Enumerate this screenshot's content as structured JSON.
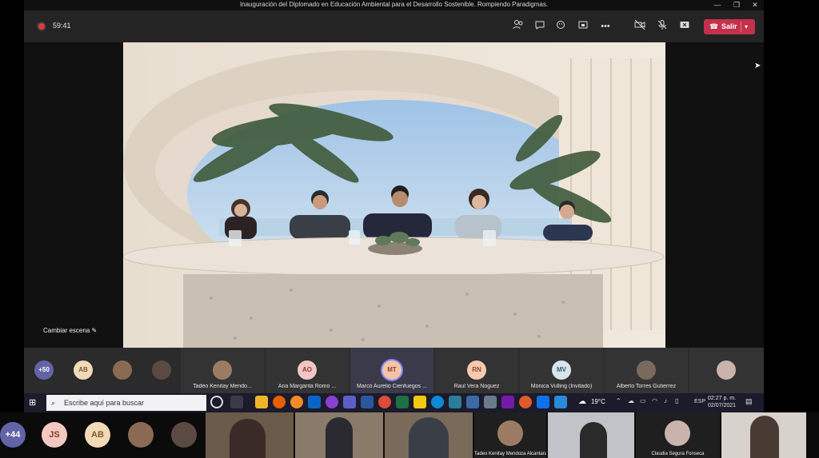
{
  "meeting": {
    "title": "Inauguración del Diplomado en Educación Ambiental para el Desarrollo Sostenible. Rompiendo Paradigmas.",
    "timer": "59:41",
    "leave_label": "Salir",
    "change_scene": "Cambiar escena"
  },
  "strip": {
    "overflow": "+50",
    "avatars": [
      {
        "initials": "AB",
        "color": "#f2d9b8"
      }
    ],
    "tiles": [
      {
        "name": "Tadeo Kenitay Mendo..."
      },
      {
        "name": "Ana Margarita Romo ...",
        "initials": "AO",
        "color": "#f3c6c6"
      },
      {
        "name": "Marco Aurelio Cienfuegos ...",
        "initials": "MT",
        "color": "#f5c4a8"
      },
      {
        "name": "Raul Vera Noguez",
        "initials": "RN",
        "color": "#f6c9b0"
      },
      {
        "name": "Mónica Vulling (Invitado)",
        "initials": "MV",
        "color": "#d7e6ea"
      },
      {
        "name": "Alberto Torres Gutierrez"
      }
    ]
  },
  "taskbar": {
    "search_placeholder": "Escribe aquí para buscar",
    "weather": "19°C",
    "lang": "ESP",
    "time": "02:27 p. m.",
    "date": "02/07/2021"
  },
  "gallery": {
    "overflow": "+44",
    "avatars": [
      {
        "initials": "JS",
        "color": "#f2c9c0"
      },
      {
        "initials": "AB",
        "color": "#f2d9b8"
      }
    ],
    "tiles": [
      {
        "name": "Tadeo Kenitay Mendoza Alcantara"
      },
      {
        "name": "Claudia Segura Fonseca"
      }
    ]
  },
  "colors": {
    "leave": "#c4314b",
    "accent": "#6264a7"
  }
}
